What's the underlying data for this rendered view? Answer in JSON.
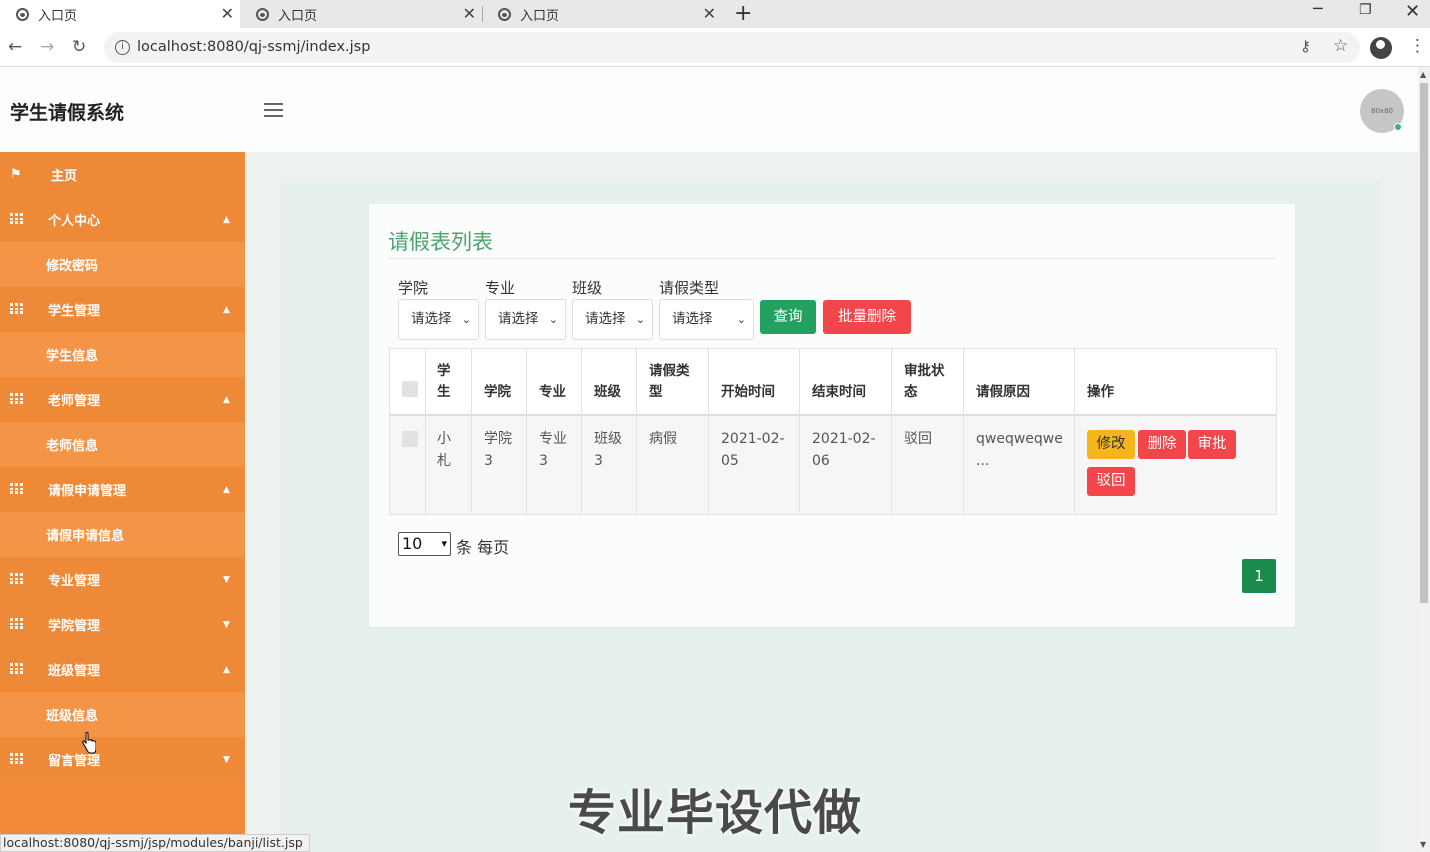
{
  "browser": {
    "tabs": [
      {
        "title": "入口页"
      },
      {
        "title": "入口页"
      },
      {
        "title": "入口页"
      }
    ],
    "url": "localhost:8080/qj-ssmj/index.jsp",
    "status_url": "localhost:8080/qj-ssmj/jsp/modules/banji/list.jsp"
  },
  "app": {
    "title": "学生请假系统",
    "avatar_text": "80x80"
  },
  "sidebar": {
    "items": [
      {
        "label": "主页",
        "type": "home"
      },
      {
        "label": "个人中心",
        "type": "parent",
        "caret": "▲"
      },
      {
        "label": "修改密码",
        "type": "child"
      },
      {
        "label": "学生管理",
        "type": "parent",
        "caret": "▲"
      },
      {
        "label": "学生信息",
        "type": "child"
      },
      {
        "label": "老师管理",
        "type": "parent",
        "caret": "▲"
      },
      {
        "label": "老师信息",
        "type": "child"
      },
      {
        "label": "请假申请管理",
        "type": "parent",
        "caret": "▲"
      },
      {
        "label": "请假申请信息",
        "type": "child"
      },
      {
        "label": "专业管理",
        "type": "parent",
        "caret": "▼"
      },
      {
        "label": "学院管理",
        "type": "parent",
        "caret": "▼"
      },
      {
        "label": "班级管理",
        "type": "parent",
        "caret": "▲"
      },
      {
        "label": "班级信息",
        "type": "child"
      },
      {
        "label": "留言管理",
        "type": "parent",
        "caret": "▼"
      }
    ]
  },
  "main": {
    "title": "请假表列表",
    "filters": [
      {
        "label": "学院",
        "value": "请选择"
      },
      {
        "label": "专业",
        "value": "请选择"
      },
      {
        "label": "班级",
        "value": "请选择"
      },
      {
        "label": "请假类型",
        "value": "请选择"
      }
    ],
    "query_button": "查询",
    "batch_delete_button": "批量删除",
    "table": {
      "headers": [
        "学生",
        "学院",
        "专业",
        "班级",
        "请假类型",
        "开始时间",
        "结束时间",
        "审批状态",
        "请假原因",
        "操作"
      ],
      "rows": [
        {
          "student": "小札",
          "college": "学院3",
          "major": "专业3",
          "class": "班级3",
          "leave_type": "病假",
          "start": "2021-02-05",
          "end": "2021-02-06",
          "status": "驳回",
          "reason": "qweqweqwe ...",
          "actions": [
            "修改",
            "删除",
            "审批",
            "驳回"
          ]
        }
      ]
    },
    "page_size": "10",
    "page_size_suffix": "条 每页",
    "current_page": "1"
  },
  "watermark": "专业毕设代做",
  "colors": {
    "sidebar": "#f08a36",
    "title_green": "#4aa470",
    "query_green": "#23a160",
    "danger_red": "#f2464a",
    "warning_yellow": "#f7b51c",
    "page_green": "#1a8a4f"
  }
}
